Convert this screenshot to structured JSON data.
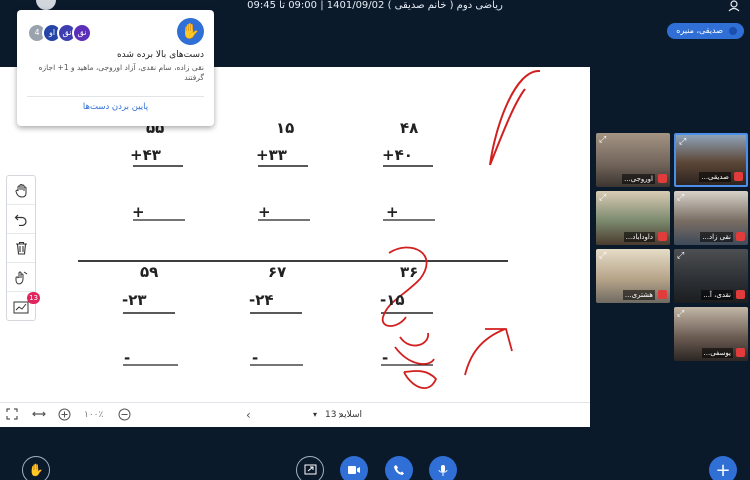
{
  "topbar": {
    "title": "ریاضی دوم ( خانم صدیقی ) 1401/09/02 | 09:00 تا 09:45"
  },
  "user_chip": {
    "name": "صدیقی، منیره"
  },
  "raise_hands": {
    "avatars": [
      {
        "label": "نق",
        "color": "#5b2fb8"
      },
      {
        "label": "نق",
        "color": "#3d3fb0"
      },
      {
        "label": "او",
        "color": "#2546a8"
      },
      {
        "label": "4",
        "color": "#9aa3ad"
      }
    ],
    "title": "دست‌های بالا برده شده",
    "names": "نقی زاده، سام نقدی، آزاد اوروجی، ماهید و 1+ اجازه گرفتند",
    "lower_button": "پایین بردن دست‌ها"
  },
  "worksheet": {
    "top_row": [
      {
        "a": "۵۵",
        "b": "+۴۳"
      },
      {
        "a": "۱۵",
        "b": "+۳۳"
      },
      {
        "a": "۴۸",
        "b": "+۴۰"
      }
    ],
    "bottom_row": [
      {
        "a": "۵۹",
        "b": "-۲۳"
      },
      {
        "a": "۶۷",
        "b": "-۲۴"
      },
      {
        "a": "۳۶",
        "b": "-۱۵"
      }
    ],
    "top_answer_sign": "+",
    "bottom_answer_sign": "-"
  },
  "tools": {
    "badge": "13",
    "items": [
      "hand-icon",
      "undo-icon",
      "trash-icon",
      "multi-user-icon",
      "chart-icon"
    ]
  },
  "slide_nav": {
    "zoom": "۱۰۰٪",
    "slide_label": "اسلاید 13"
  },
  "participants": [
    {
      "name": "صدیقی...",
      "active": true,
      "tone": "#5c4636"
    },
    {
      "name": "اوروجی...",
      "active": false,
      "tone": "#6f6258"
    },
    {
      "name": "نقی زاد...",
      "active": false,
      "tone": "#7a6e63"
    },
    {
      "name": "داوداباد...",
      "active": false,
      "tone": "#7c8a6e"
    },
    {
      "name": "نقدی، آ...",
      "active": false,
      "tone": "#2b2f33"
    },
    {
      "name": "هشتری...",
      "active": false,
      "tone": "#b7a58a"
    },
    {
      "name": "یوسفی...",
      "active": false,
      "tone": "#6c5d54"
    }
  ],
  "colors": {
    "accent": "#2f6fd6",
    "bg": "#0b1a2b",
    "ink": "#d21f1f"
  }
}
